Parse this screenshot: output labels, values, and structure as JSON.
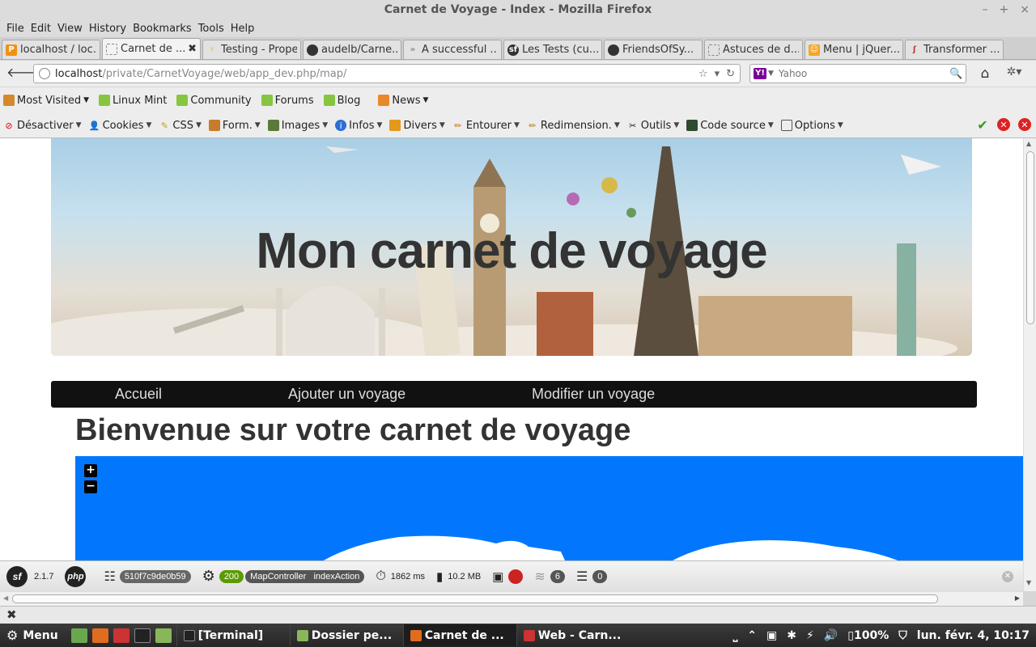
{
  "window": {
    "title": "Carnet de Voyage - Index - Mozilla Firefox"
  },
  "menubar": [
    "File",
    "Edit",
    "View",
    "History",
    "Bookmarks",
    "Tools",
    "Help"
  ],
  "tabs": [
    {
      "label": "localhost / loc...",
      "icon_color": "#f29111"
    },
    {
      "label": "Carnet de ...",
      "icon_color": "#ffffff",
      "active": true
    },
    {
      "label": "Testing - Propel",
      "icon_color": "#e8c13c"
    },
    {
      "label": "audelb/Carne...",
      "icon_color": "#333333"
    },
    {
      "label": "A successful ...",
      "icon_color": "#888888"
    },
    {
      "label": "Les Tests (cu...",
      "icon_color": "#333333"
    },
    {
      "label": "FriendsOfSy...",
      "icon_color": "#333333"
    },
    {
      "label": "Astuces de d...",
      "icon_color": "#ffffff"
    },
    {
      "label": "Menu | jQuer...",
      "icon_color": "#f5a623"
    },
    {
      "label": "Transformer ...",
      "icon_color": "#c0392b"
    }
  ],
  "navbar": {
    "url_host": "localhost",
    "url_path": "/private/CarnetVoyage/web/app_dev.php/map/",
    "search_placeholder": "Yahoo"
  },
  "bookmarks": [
    "Most Visited",
    "Linux Mint",
    "Community",
    "Forums",
    "Blog",
    "News"
  ],
  "devtoolbar": {
    "items": [
      "Désactiver",
      "Cookies",
      "CSS",
      "Form.",
      "Images",
      "Infos",
      "Divers",
      "Entourer",
      "Redimension.",
      "Outils",
      "Code source",
      "Options"
    ]
  },
  "page": {
    "banner_title": "Mon carnet de voyage",
    "nav": [
      "Accueil",
      "Ajouter un voyage",
      "Modifier un voyage"
    ],
    "heading": "Bienvenue sur votre carnet de voyage",
    "map_zoom_in": "+",
    "map_zoom_out": "−"
  },
  "symfony_bar": {
    "version": "2.1.7",
    "php_label": "php",
    "token": "510f7c9de0b59",
    "status": "200",
    "controller": "MapController",
    "action": "indexAction",
    "time": "1862 ms",
    "memory": "10.2 MB",
    "queries_count": "6",
    "logs_count": "0"
  },
  "taskbar": {
    "menu_label": "Menu",
    "tasks": [
      "[Terminal]",
      "Dossier pe...",
      "Carnet de ...",
      "Web - Carn..."
    ],
    "battery": "100%",
    "clock": "lun. févr.  4, 10:17"
  }
}
